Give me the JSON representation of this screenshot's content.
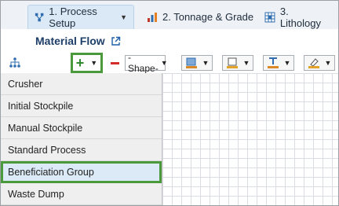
{
  "tabs": [
    {
      "label": "1. Process Setup",
      "active": true,
      "has_dropdown": true,
      "icon": "process-setup-icon"
    },
    {
      "label": "2. Tonnage & Grade",
      "active": false,
      "icon": "chart-icon"
    },
    {
      "label": "3. Lithology",
      "active": false,
      "icon": "grid-icon"
    }
  ],
  "header": {
    "title": "Material Flow",
    "popout_icon": "external-link-icon"
  },
  "toolbar": {
    "add_icon": "plus-icon",
    "remove_icon": "minus-icon",
    "shape_select": "-Shape-",
    "buttons": [
      "fill-color-icon",
      "line-color-icon",
      "text-color-icon",
      "highlight-icon"
    ]
  },
  "menu": {
    "items": [
      "Crusher",
      "Initial Stockpile",
      "Manual Stockpile",
      "Standard Process",
      "Beneficiation Group",
      "Waste Dump"
    ],
    "highlighted_index": 4
  },
  "colors": {
    "accent": "#4a9a3c",
    "title": "#1d3e69",
    "remove": "#d62b2b"
  }
}
